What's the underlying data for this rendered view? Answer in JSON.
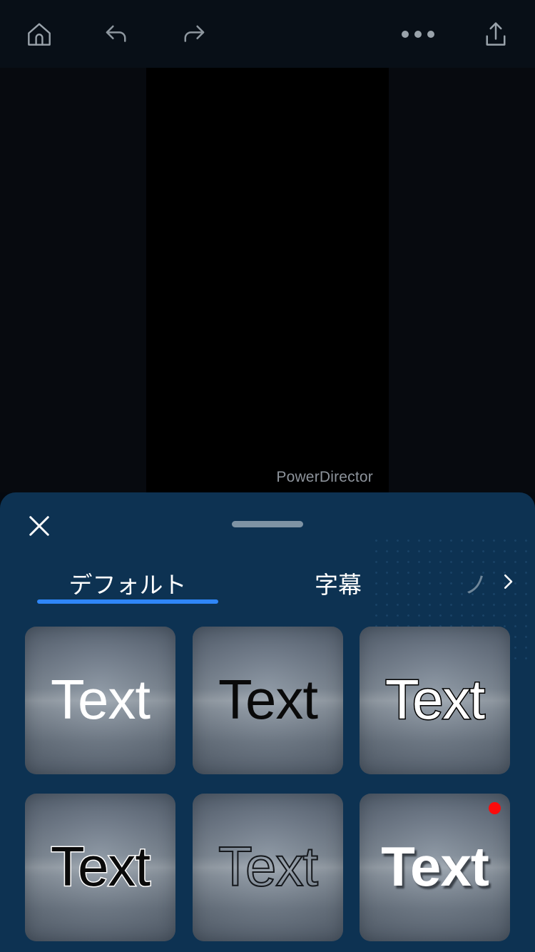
{
  "toolbar": {
    "home_label": "home-icon",
    "undo_label": "undo-icon",
    "redo_label": "redo-icon",
    "more_label": "more-icon",
    "share_label": "share-icon"
  },
  "preview": {
    "watermark": "PowerDirector",
    "canvas_color": "#000000",
    "background_color": "#070a0f"
  },
  "sheet": {
    "close_label": "×",
    "accent_color": "#2f86f7",
    "background_color": "#0d3252",
    "tabs": [
      {
        "label": "デフォルト",
        "active": true
      },
      {
        "label": "字幕",
        "active": false
      },
      {
        "label": "ノ",
        "active": false
      }
    ],
    "chevron_label": "›"
  },
  "grid": {
    "items": [
      {
        "text": "Text",
        "style": "st-white",
        "badge": false
      },
      {
        "text": "Text",
        "style": "st-black",
        "badge": false
      },
      {
        "text": "Text",
        "style": "st-white-outline",
        "badge": false
      },
      {
        "text": "Text",
        "style": "st-black-outline",
        "badge": false
      },
      {
        "text": "Text",
        "style": "st-hollow",
        "badge": false
      },
      {
        "text": "Text",
        "style": "st-bold-shadow",
        "badge": true
      }
    ],
    "badge_color": "#fb0b0b"
  }
}
